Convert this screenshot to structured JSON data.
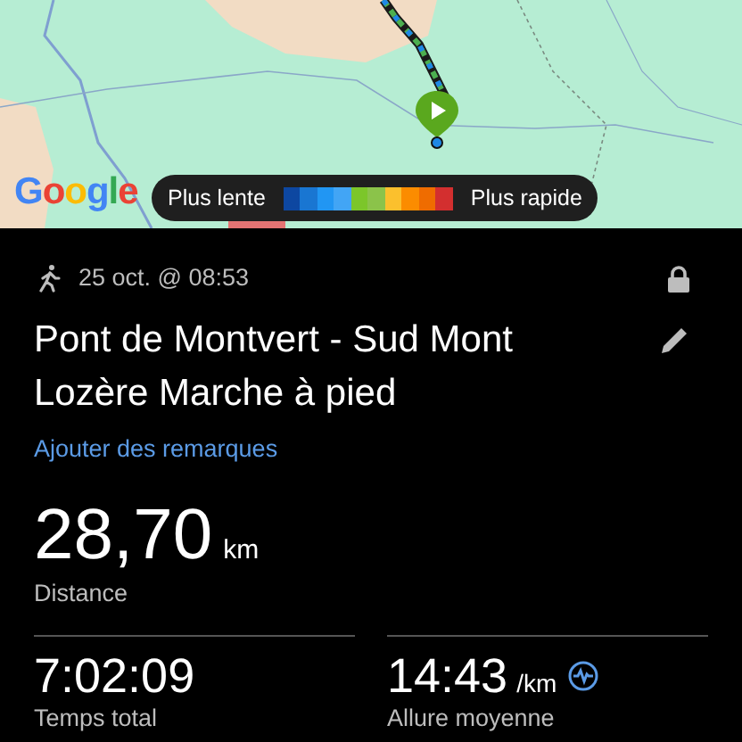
{
  "map": {
    "attribution": "Google",
    "legend": {
      "slow_label": "Plus lente",
      "fast_label": "Plus rapide",
      "segments": [
        {
          "color": "#0d47a1"
        },
        {
          "color": "#1976d2"
        },
        {
          "color": "#2196f3"
        },
        {
          "color": "#42a5f5"
        },
        {
          "color": "#7cc62a"
        },
        {
          "color": "#8bc34a"
        },
        {
          "color": "#fbc02d"
        },
        {
          "color": "#fb8c00"
        },
        {
          "color": "#ef6c00"
        },
        {
          "color": "#d32f2f"
        }
      ]
    }
  },
  "activity": {
    "date": "25 oct. @ 08:53",
    "locked": true,
    "title": "Pont de Montvert - Sud Mont Lozère Marche à pied",
    "notes_link": "Ajouter des remarques"
  },
  "stats": [
    {
      "value": "28,70",
      "unit": "km",
      "label": "Distance",
      "kind": "main"
    },
    {
      "value": "7:02:09",
      "label": "Temps total",
      "kind": "half"
    },
    {
      "value": "14:43",
      "unit": "/km",
      "label": "Allure moyenne",
      "kind": "half",
      "info": true
    }
  ]
}
